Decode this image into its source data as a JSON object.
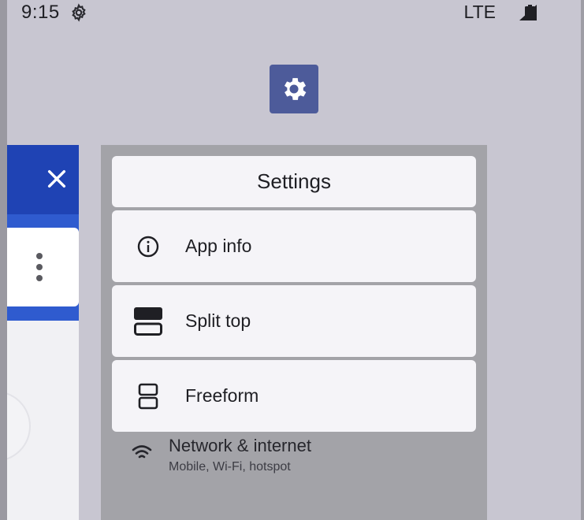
{
  "status_bar": {
    "time": "9:15",
    "network": "LTE",
    "icons": [
      "settings-gear-icon",
      "signal-icon",
      "battery-icon"
    ]
  },
  "app_icon": {
    "name": "settings-app-icon",
    "color": "#4d5b9a"
  },
  "left_app": {
    "header_color": "#1f43b4",
    "close_icon": "close-icon",
    "more_icon": "more-vert-icon"
  },
  "menu": {
    "title": "Settings",
    "items": [
      {
        "label": "App info",
        "icon": "info-icon"
      },
      {
        "label": "Split top",
        "icon": "split-top-icon"
      },
      {
        "label": "Freeform",
        "icon": "freeform-icon"
      }
    ]
  },
  "settings_preview": {
    "row_title": "Network & internet",
    "row_subtitle": "Mobile, Wi-Fi, hotspot",
    "row_icon": "wifi-icon"
  }
}
